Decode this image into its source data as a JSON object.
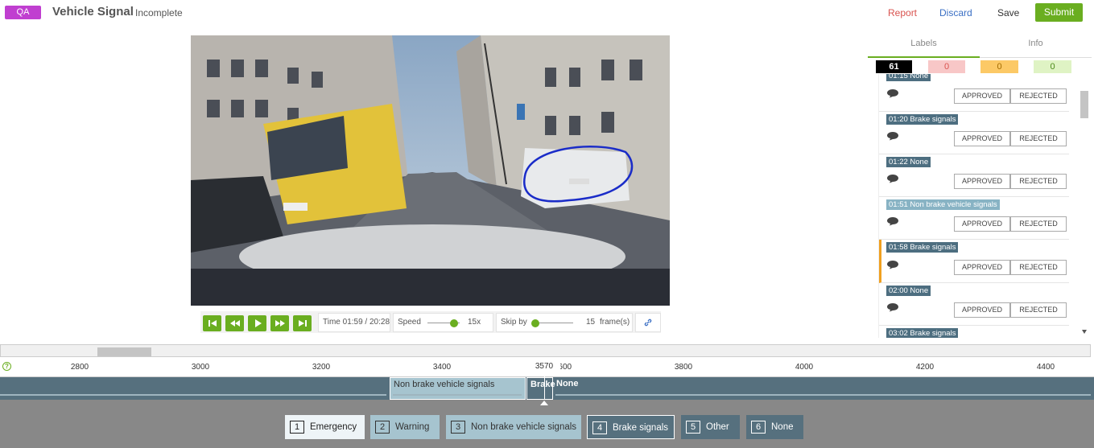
{
  "header": {
    "mode_badge": "QA",
    "title": "Vehicle Signal",
    "status": "Incomplete",
    "report_label": "Report",
    "discard_label": "Discard",
    "save_label": "Save",
    "submit_label": "Submit"
  },
  "controls": {
    "time_text": "Time 01:59 / 20:28",
    "speed_label": "Speed",
    "speed_value": "15x",
    "skip_label": "Skip by",
    "skip_value": "15",
    "skip_unit": "frame(s)"
  },
  "panel": {
    "tabs": [
      "Labels",
      "Info"
    ],
    "counters": {
      "total": "61",
      "red": "0",
      "orange": "0",
      "green": "0"
    },
    "approved_label": "APPROVED",
    "rejected_label": "REJECTED",
    "items": [
      {
        "tag": "01:15 None",
        "style": "dark"
      },
      {
        "tag": "01:20 Brake signals",
        "style": "dark"
      },
      {
        "tag": "01:22 None",
        "style": "dark"
      },
      {
        "tag": "01:51 Non brake vehicle signals",
        "style": "light"
      },
      {
        "tag": "01:58 Brake signals",
        "style": "dark"
      },
      {
        "tag": "02:00 None",
        "style": "dark"
      },
      {
        "tag": "03:02 Brake signals",
        "style": "dark"
      }
    ]
  },
  "timeline": {
    "ticks": [
      "2800",
      "3000",
      "3200",
      "3400",
      "3600",
      "3800",
      "4000",
      "4200",
      "4400"
    ],
    "playhead": "3570",
    "help": "?",
    "segments": {
      "nonbrake": "Non brake vehicle signals",
      "brake": "Brake",
      "none": "None"
    }
  },
  "categories": [
    {
      "key": "1",
      "label": "Emergency"
    },
    {
      "key": "2",
      "label": "Warning"
    },
    {
      "key": "3",
      "label": "Non brake vehicle signals"
    },
    {
      "key": "4",
      "label": "Brake signals"
    },
    {
      "key": "5",
      "label": "Other"
    },
    {
      "key": "6",
      "label": "None"
    }
  ],
  "colors": {
    "accent": "#6aae20",
    "qa_badge": "#c03fd0",
    "report": "#d9534f",
    "discard": "#3a6fc4",
    "active_item": "#f0a020"
  }
}
